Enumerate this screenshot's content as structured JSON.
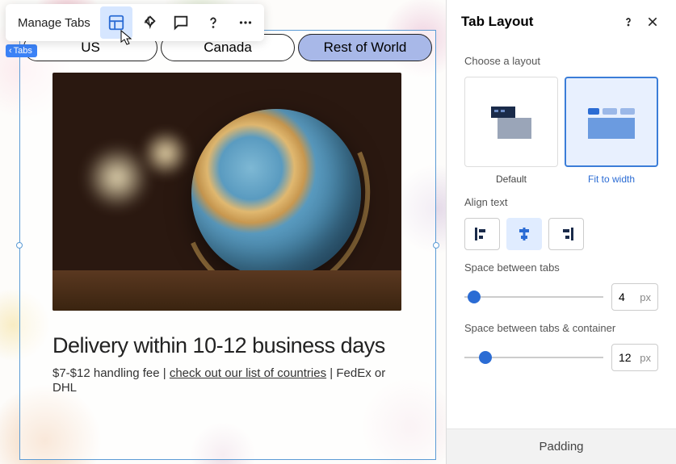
{
  "toolbar": {
    "manage_tabs": "Manage Tabs",
    "badge": "Tabs"
  },
  "tabs": {
    "items": [
      "US",
      "Canada",
      "Rest of World"
    ],
    "active_index": 2
  },
  "content": {
    "headline": "Delivery within 10-12 business days",
    "fee_prefix": "$7-$12 handling fee | ",
    "link": "check out our list of countries",
    "fee_suffix": " | FedEx or DHL"
  },
  "panel": {
    "title": "Tab Layout",
    "choose": "Choose a layout",
    "layout_default": "Default",
    "layout_fit": "Fit to width",
    "align": "Align text",
    "space_tabs": "Space between tabs",
    "space_tabs_val": "4",
    "space_container": "Space between tabs & container",
    "space_container_val": "12",
    "unit": "px",
    "padding": "Padding"
  }
}
